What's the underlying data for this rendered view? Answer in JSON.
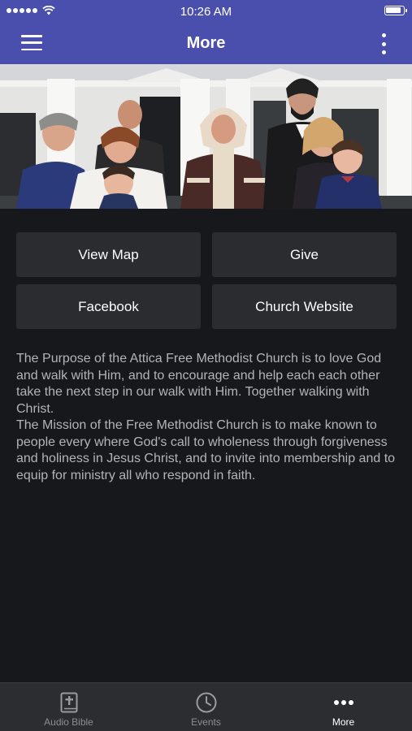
{
  "status_bar": {
    "time": "10:26 AM"
  },
  "nav": {
    "title": "More"
  },
  "hero": {
    "alt": ""
  },
  "buttons": [
    {
      "label": "View Map"
    },
    {
      "label": "Give"
    },
    {
      "label": "Facebook"
    },
    {
      "label": "Church Website"
    }
  ],
  "description": {
    "paragraph1": "The Purpose of the Attica Free Methodist Church is to love God and walk with Him, and to encourage and help each each other take the next step in our walk with Him. Together walking with Christ.",
    "paragraph2": "The Mission of the Free Methodist Church is to make known to people every where God's call to wholeness through forgiveness and holiness in Jesus Christ, and to invite into membership and to equip for ministry all who respond in faith."
  },
  "tab_bar": {
    "tabs": [
      {
        "label": "Audio Bible",
        "icon": "bible-icon",
        "active": false
      },
      {
        "label": "Events",
        "icon": "clock-icon",
        "active": false
      },
      {
        "label": "More",
        "icon": "more-dots-icon",
        "active": true
      }
    ]
  },
  "colors": {
    "nav_background": "#4a4fae",
    "page_background": "#17181c",
    "button_background": "#2b2c30",
    "tab_bar_background": "#2c2d31",
    "body_text": "#b3b4ba"
  }
}
